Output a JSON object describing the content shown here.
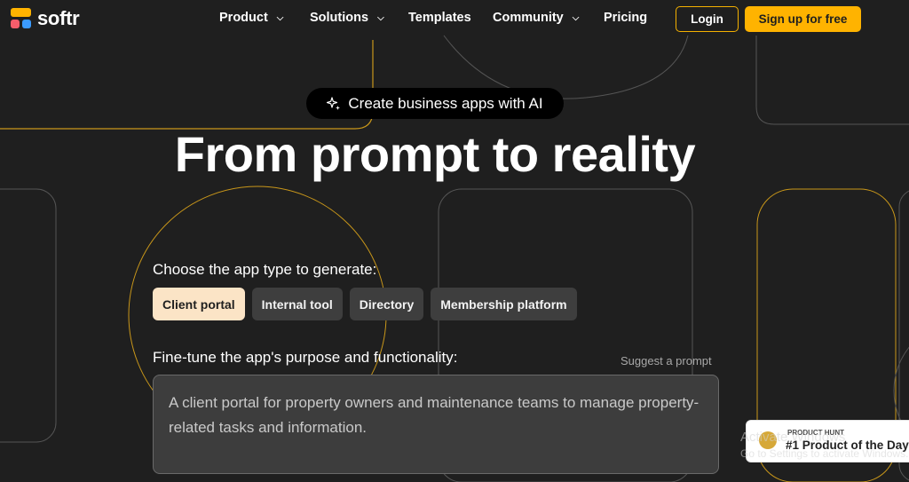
{
  "nav": {
    "logo_text": "softr",
    "items": [
      {
        "label": "Product",
        "has_dropdown": true
      },
      {
        "label": "Solutions",
        "has_dropdown": true
      },
      {
        "label": "Templates",
        "has_dropdown": false
      },
      {
        "label": "Community",
        "has_dropdown": true
      },
      {
        "label": "Pricing",
        "has_dropdown": false
      }
    ],
    "login_label": "Login",
    "signup_label": "Sign up for free"
  },
  "hero": {
    "pill_label": "Create business apps with AI",
    "pill_icon": "sparkle-icon",
    "title": "From prompt to reality"
  },
  "generator": {
    "app_type_label": "Choose the app type to generate:",
    "app_types": [
      {
        "label": "Client portal",
        "selected": true
      },
      {
        "label": "Internal tool",
        "selected": false
      },
      {
        "label": "Directory",
        "selected": false
      },
      {
        "label": "Membership platform",
        "selected": false
      }
    ],
    "purpose_label": "Fine-tune the app's purpose and functionality:",
    "suggest_label": "Suggest a prompt",
    "prompt_value": "A client portal for property owners and maintenance teams to manage property-related tasks and information."
  },
  "badge": {
    "top": "PRODUCT HUNT",
    "main": "#1 Product of the Day"
  },
  "watermark": {
    "line1": "Activate Windows",
    "line2": "Go to Settings to activate Windows."
  },
  "colors": {
    "background": "#1f1f1f",
    "accent": "#ffb300",
    "chip_active": "#fbe4c6",
    "chip": "#3e3e3e"
  }
}
